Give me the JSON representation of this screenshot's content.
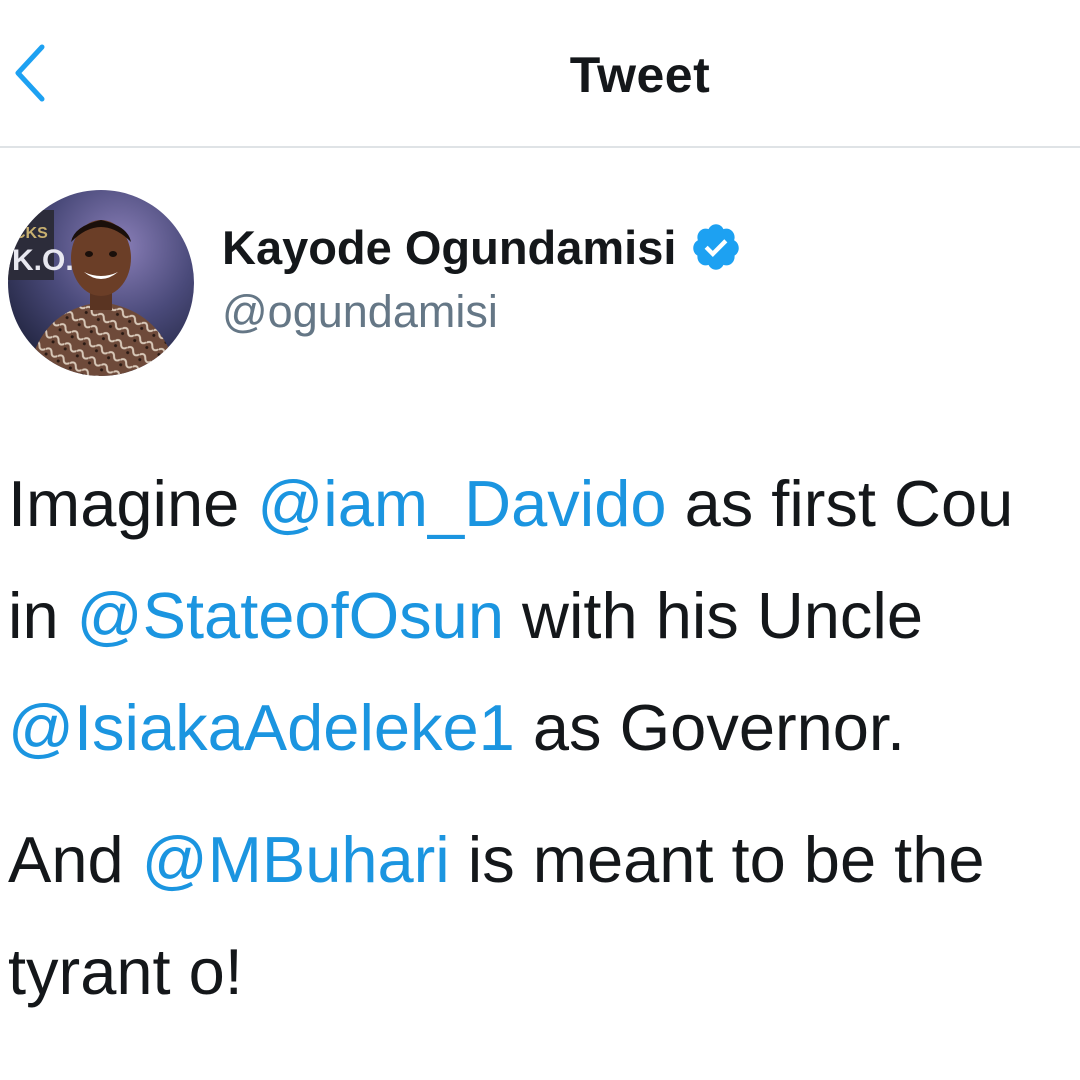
{
  "header": {
    "title": "Tweet",
    "back_icon": "chevron-left-icon",
    "accent_color": "#1da1f2"
  },
  "tweet": {
    "author": {
      "name": "Kayode Ogundamisi",
      "handle": "@ogundamisi",
      "verified": true,
      "verified_icon": "verified-badge-icon",
      "verified_color": "#1da1f2",
      "avatar_badge_text": "CKS K.O."
    },
    "mention_color": "#1b95e0",
    "paragraphs": [
      {
        "lines": [
          [
            {
              "text": "Imagine ",
              "mention": false
            },
            {
              "text": "@iam_Davido",
              "mention": true
            },
            {
              "text": " as first Cou",
              "mention": false
            }
          ],
          [
            {
              "text": "in ",
              "mention": false
            },
            {
              "text": "@StateofOsun",
              "mention": true
            },
            {
              "text": " with his Uncle",
              "mention": false
            }
          ],
          [
            {
              "text": "@IsiakaAdeleke1",
              "mention": true
            },
            {
              "text": " as Governor.",
              "mention": false
            }
          ]
        ]
      },
      {
        "lines": [
          [
            {
              "text": "And ",
              "mention": false
            },
            {
              "text": "@MBuhari",
              "mention": true
            },
            {
              "text": " is meant to be the",
              "mention": false
            }
          ],
          [
            {
              "text": "tyrant o!",
              "mention": false
            }
          ]
        ]
      }
    ]
  }
}
